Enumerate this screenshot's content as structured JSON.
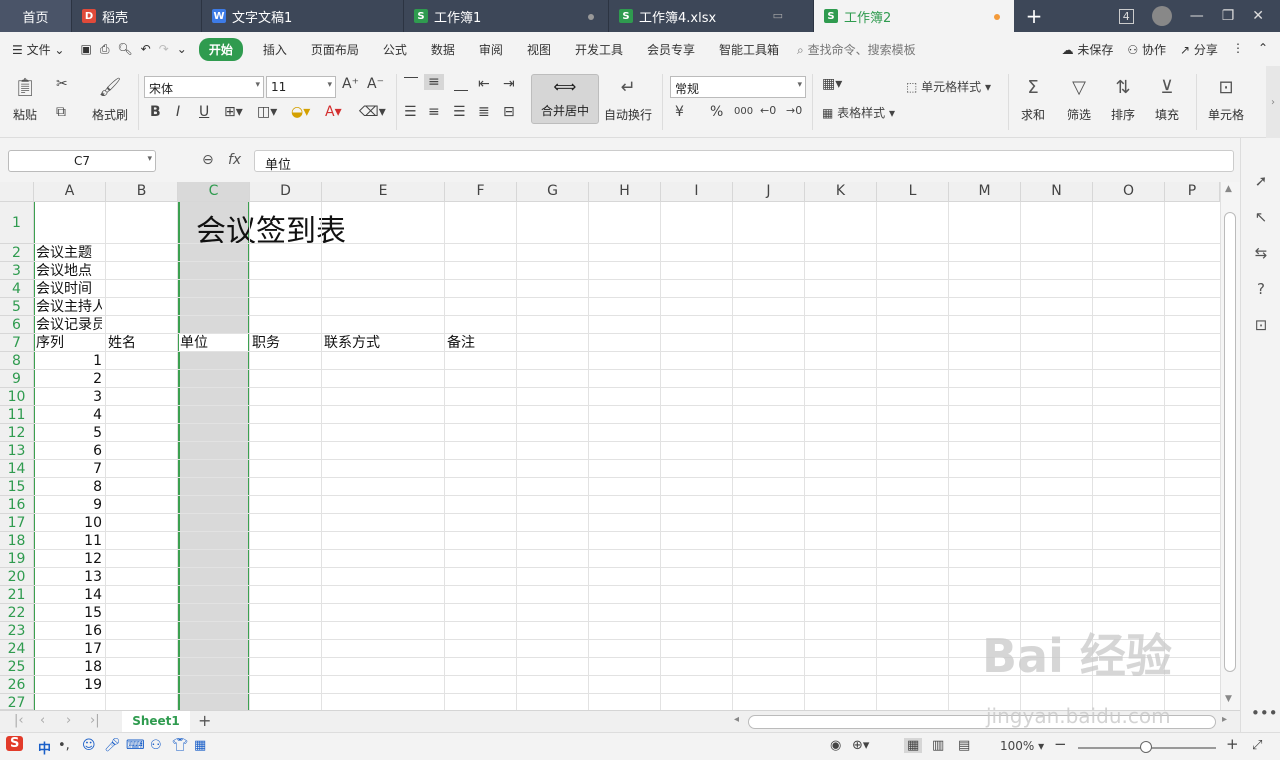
{
  "tabs": [
    {
      "label": "首页"
    },
    {
      "label": "稻壳",
      "icon": "daoke-icon",
      "color": "#e04a3a"
    },
    {
      "label": "文字文稿1",
      "icon": "word-icon",
      "color": "#3d7be6"
    },
    {
      "label": "工作簿1",
      "icon": "sheet-icon",
      "color": "#2f9b4f"
    },
    {
      "label": "工作簿4.xlsx",
      "icon": "sheet-icon",
      "color": "#2f9b4f"
    },
    {
      "label": "工作簿2",
      "icon": "sheet-icon",
      "color": "#2f9b4f"
    }
  ],
  "window": {
    "badge": "4"
  },
  "menu": {
    "file": "文件",
    "start": "开始",
    "items": [
      "插入",
      "页面布局",
      "公式",
      "数据",
      "审阅",
      "视图",
      "开发工具",
      "会员专享",
      "智能工具箱"
    ],
    "search": "查找命令、搜索模板",
    "unsaved": "未保存",
    "collab": "协作",
    "share": "分享"
  },
  "ribbon": {
    "paste": "粘贴",
    "format_painter": "格式刷",
    "font_name": "宋体",
    "font_size": "11",
    "merge_center": "合并居中",
    "auto_wrap": "自动换行",
    "number_format": "常规",
    "cell_style": "单元格样式",
    "table_style": "表格样式",
    "sum": "求和",
    "filter": "筛选",
    "sort": "排序",
    "fill": "填充",
    "cell": "单元格",
    "bold": "B",
    "italic": "I",
    "underline": "U",
    "currency": "¥",
    "percent": "%",
    "thousands": "000"
  },
  "formula": {
    "cell_ref": "C7",
    "content": "单位",
    "fx": "fx"
  },
  "columns": [
    "A",
    "B",
    "C",
    "D",
    "E",
    "F",
    "G",
    "H",
    "I",
    "J",
    "K",
    "L",
    "M",
    "N",
    "O",
    "P"
  ],
  "rows": [
    "1",
    "2",
    "3",
    "4",
    "5",
    "6",
    "7",
    "8",
    "9",
    "10",
    "11",
    "12",
    "13",
    "14",
    "15",
    "16",
    "17",
    "18",
    "19",
    "20",
    "21",
    "22",
    "23",
    "24",
    "25",
    "26",
    "27"
  ],
  "cells": {
    "title": "会议签到表",
    "a2": "会议主题",
    "a3": "会议地点",
    "a4": "会议时间",
    "a5": "会议主持人",
    "a6": "会议记录员",
    "a7": "序列",
    "b7": "姓名",
    "c7": "单位",
    "d7": "职务",
    "e7": "联系方式",
    "f7": "备注",
    "seq": [
      "1",
      "2",
      "3",
      "4",
      "5",
      "6",
      "7",
      "8",
      "9",
      "10",
      "11",
      "12",
      "13",
      "14",
      "15",
      "16",
      "17",
      "18",
      "19"
    ]
  },
  "sheet": {
    "name": "Sheet1"
  },
  "status": {
    "zoom": "100%",
    "ime": "中"
  },
  "watermark": {
    "text": "Bai 经验",
    "url": "jingyan.baidu.com"
  }
}
